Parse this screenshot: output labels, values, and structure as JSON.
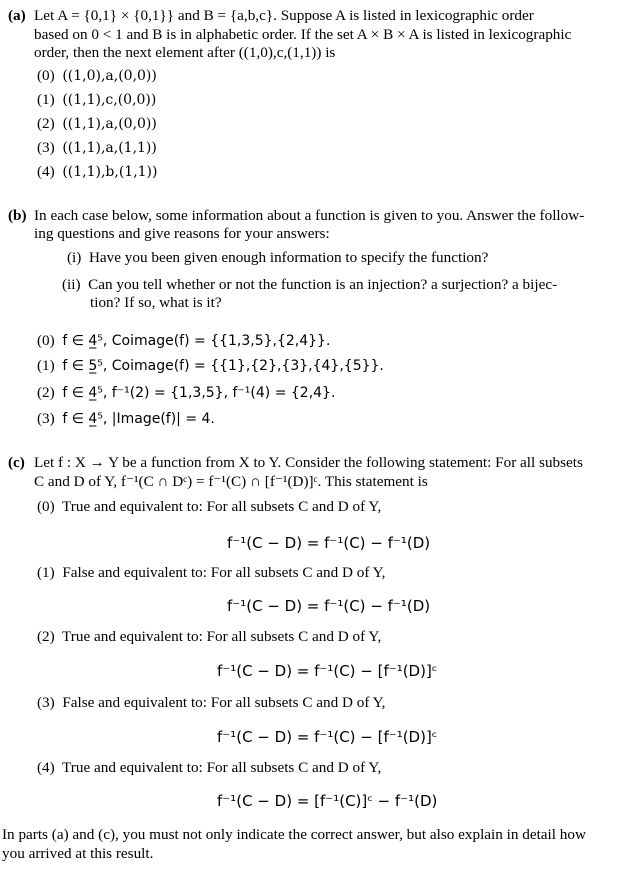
{
  "part_a": {
    "label": "(a)",
    "lines": [
      "Let A = {0,1} × {0,1}} and B = {a,b,c}. Suppose A is listed in lexicographic order",
      "based on 0 < 1 and B is in alphabetic order. If the set A × B × A is listed in lexicographic",
      "order, then the next element after ((1,0),c,(1,1)) is"
    ],
    "options": [
      {
        "num": "(0)",
        "text": "((1,0),a,(0,0))"
      },
      {
        "num": "(1)",
        "text": "((1,1),c,(0,0))"
      },
      {
        "num": "(2)",
        "text": "((1,1),a,(0,0))"
      },
      {
        "num": "(3)",
        "text": "((1,1),a,(1,1))"
      },
      {
        "num": "(4)",
        "text": "((1,1),b,(1,1))"
      }
    ]
  },
  "part_b": {
    "label": "(b)",
    "lines": [
      "In each case below, some information about a function is given to you. Answer the follow-",
      "ing questions and give reasons for your answers:"
    ],
    "questions": [
      {
        "num": "(i)",
        "lines": [
          "Have you been given enough information to specify the function?"
        ]
      },
      {
        "num": "(ii)",
        "lines": [
          "Can you tell whether or not the function is an injection? a surjection? a bijec-",
          "tion? If so, what is it?"
        ]
      }
    ],
    "options": [
      {
        "num": "(0)",
        "text": "f ∈ 4̲⁵, Coimage(f) = {{1,3,5},{2,4}}."
      },
      {
        "num": "(1)",
        "text": "f ∈ 5̲⁵, Coimage(f) = {{1},{2},{3},{4},{5}}."
      },
      {
        "num": "(2)",
        "text": "f ∈ 4̲⁵, f⁻¹(2) = {1,3,5}, f⁻¹(4) = {2,4}."
      },
      {
        "num": "(3)",
        "text": "f ∈ 4̲⁵, |Image(f)| = 4."
      }
    ]
  },
  "part_c": {
    "label": "(c)",
    "lines": [
      "Let f : X → Y be a function from X to Y. Consider the following statement: For all subsets",
      "C and D of Y, f⁻¹(C ∩ Dᶜ) = f⁻¹(C) ∩ [f⁻¹(D)]ᶜ. This statement is"
    ],
    "options": [
      {
        "num": "(0)",
        "text": "True and equivalent to: For all subsets C and D of Y,",
        "equation": "f⁻¹(C − D) = f⁻¹(C) − f⁻¹(D)"
      },
      {
        "num": "(1)",
        "text": "False and equivalent to: For all subsets C and D of Y,",
        "equation": "f⁻¹(C − D) = f⁻¹(C) − f⁻¹(D)"
      },
      {
        "num": "(2)",
        "text": "True and equivalent to: For all subsets C and D of Y,",
        "equation": "f⁻¹(C − D) = f⁻¹(C) − [f⁻¹(D)]ᶜ"
      },
      {
        "num": "(3)",
        "text": "False and equivalent to: For all subsets C and D of Y,",
        "equation": "f⁻¹(C − D) = f⁻¹(C) − [f⁻¹(D)]ᶜ"
      },
      {
        "num": "(4)",
        "text": "True and equivalent to: For all subsets C and D of Y,",
        "equation": "f⁻¹(C − D) = [f⁻¹(C)]ᶜ − f⁻¹(D)"
      }
    ]
  },
  "footer": {
    "lines": [
      "In parts (a) and (c), you must not only indicate the correct answer, but also explain in detail how",
      "you arrived at this result."
    ]
  }
}
